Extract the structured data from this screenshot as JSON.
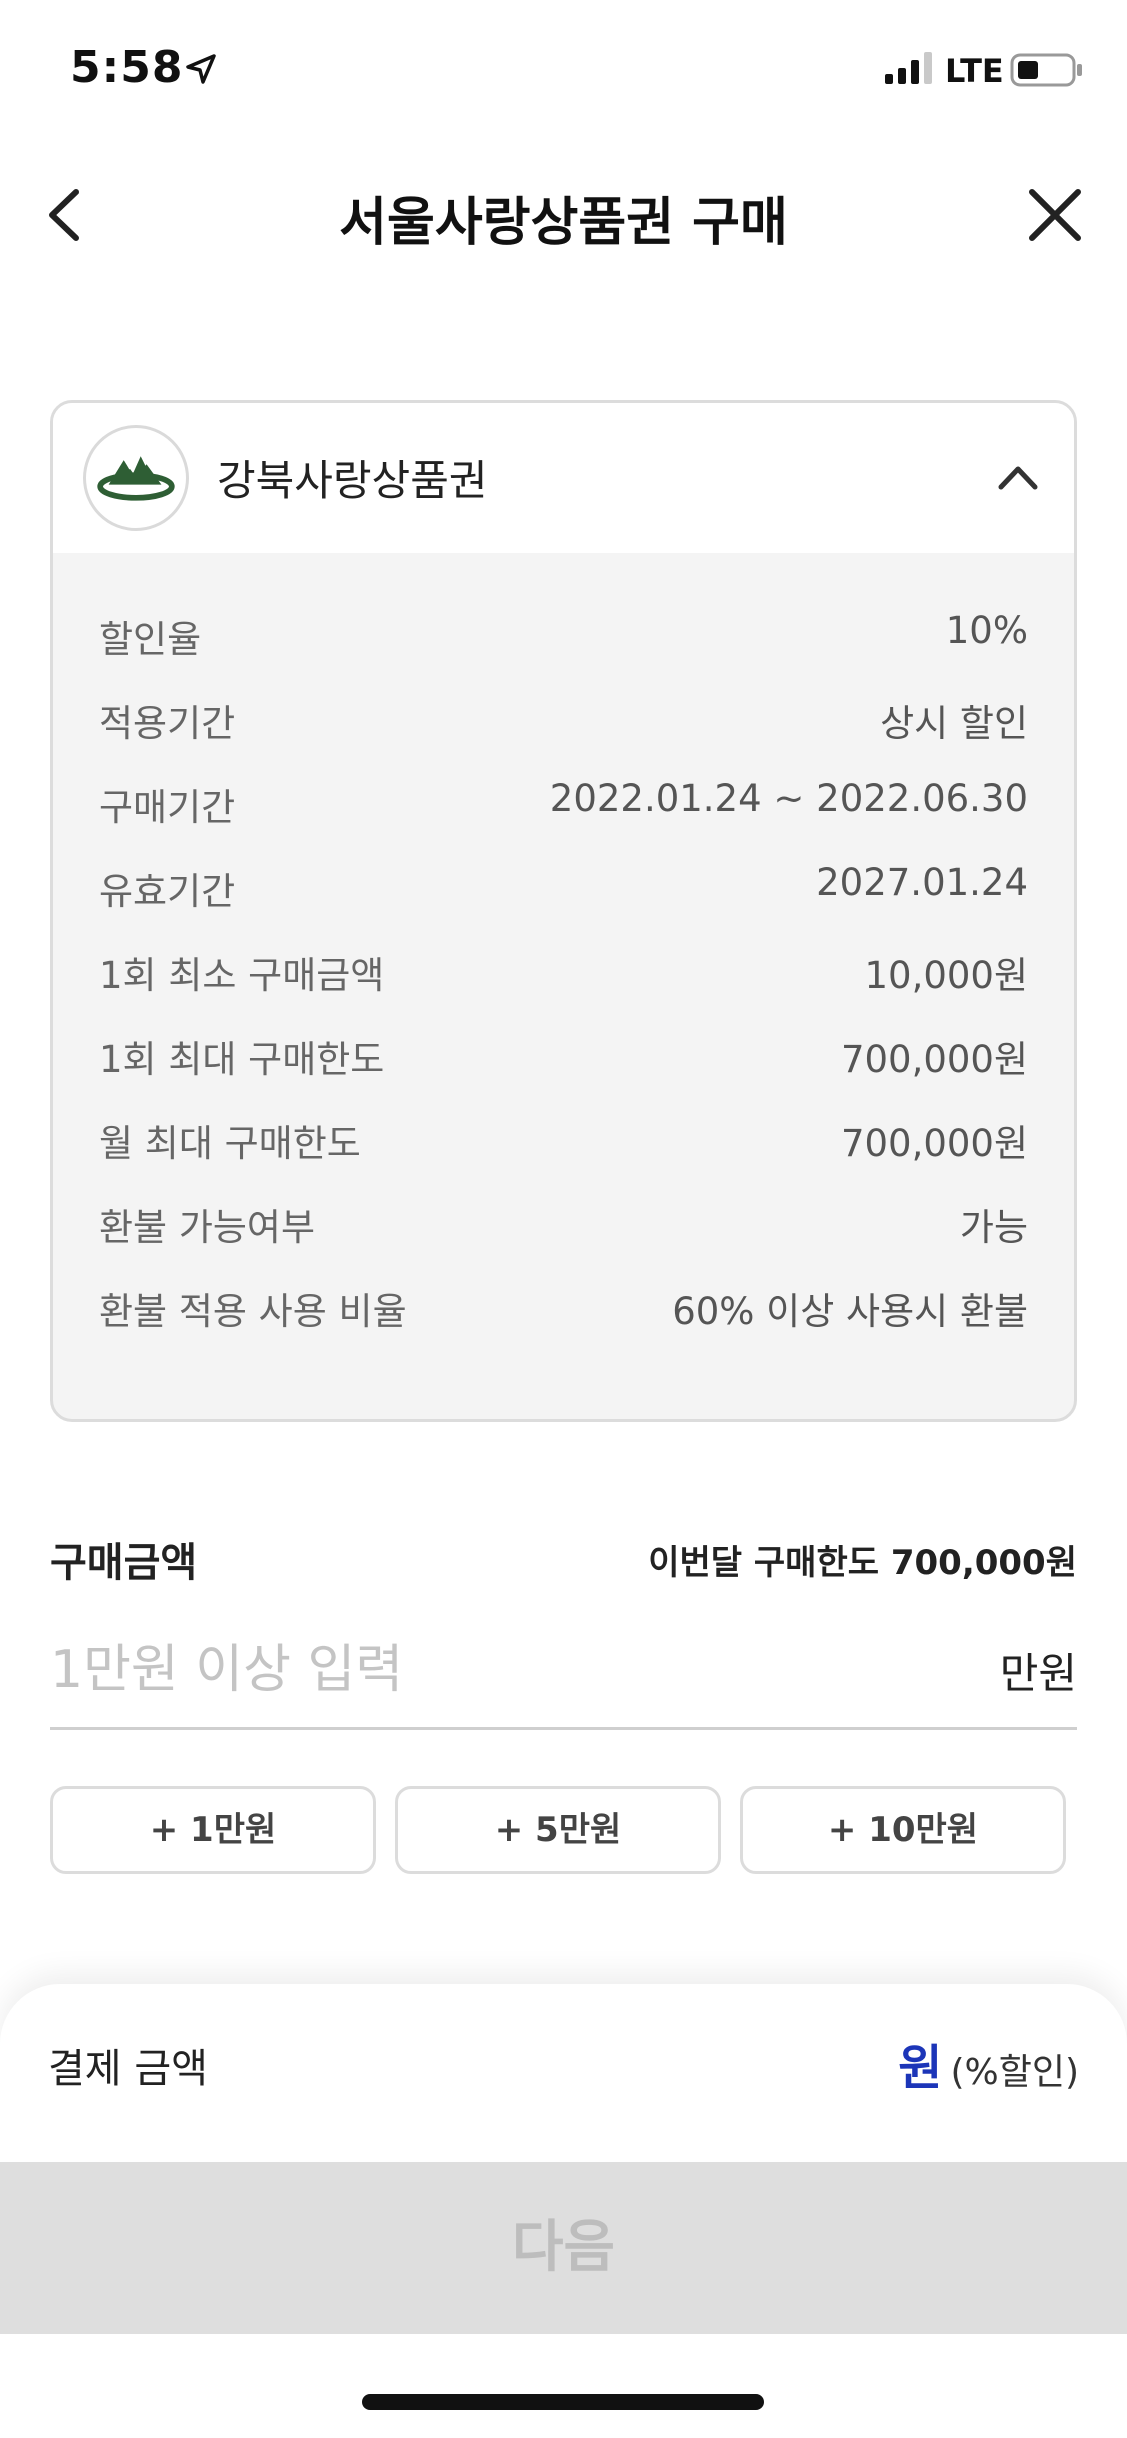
{
  "status_bar": {
    "time": "5:58",
    "network": "LTE",
    "icons": [
      "location-arrow-icon",
      "signal-bars-icon",
      "battery-icon"
    ]
  },
  "header": {
    "title": "서울사랑상품권 구매",
    "back_icon": "chevron-left-icon",
    "close_icon": "close-icon"
  },
  "voucher": {
    "name": "강북사랑상품권",
    "logo_icon": "mountain-logo-icon",
    "expand_icon": "chevron-up-icon",
    "details": [
      {
        "label": "할인율",
        "value": "10%"
      },
      {
        "label": "적용기간",
        "value": "상시 할인"
      },
      {
        "label": "구매기간",
        "value": "2022.01.24 ~ 2022.06.30"
      },
      {
        "label": "유효기간",
        "value": "2027.01.24"
      },
      {
        "label": "1회 최소 구매금액",
        "value": "10,000원"
      },
      {
        "label": "1회 최대 구매한도",
        "value": "700,000원"
      },
      {
        "label": "월 최대 구매한도",
        "value": "700,000원"
      },
      {
        "label": "환불 가능여부",
        "value": "가능"
      },
      {
        "label": "환불 적용 사용 비율",
        "value": "60% 이상 사용시 환불"
      }
    ]
  },
  "purchase": {
    "label": "구매금액",
    "limit_text": "이번달 구매한도 700,000원",
    "input_value": "",
    "input_placeholder": "1만원 이상 입력",
    "unit": "만원",
    "quick_buttons": [
      "+ 1만원",
      "+ 5만원",
      "+ 10만원"
    ]
  },
  "payment": {
    "label": "결제 금액",
    "unit": "원",
    "discount": "(%할인)",
    "next_label": "다음"
  },
  "colors": {
    "accent": "#1c35b8",
    "logo_green": "#2e5e34",
    "disabled_button": "#dedede",
    "card_background": "#f4f4f4"
  }
}
